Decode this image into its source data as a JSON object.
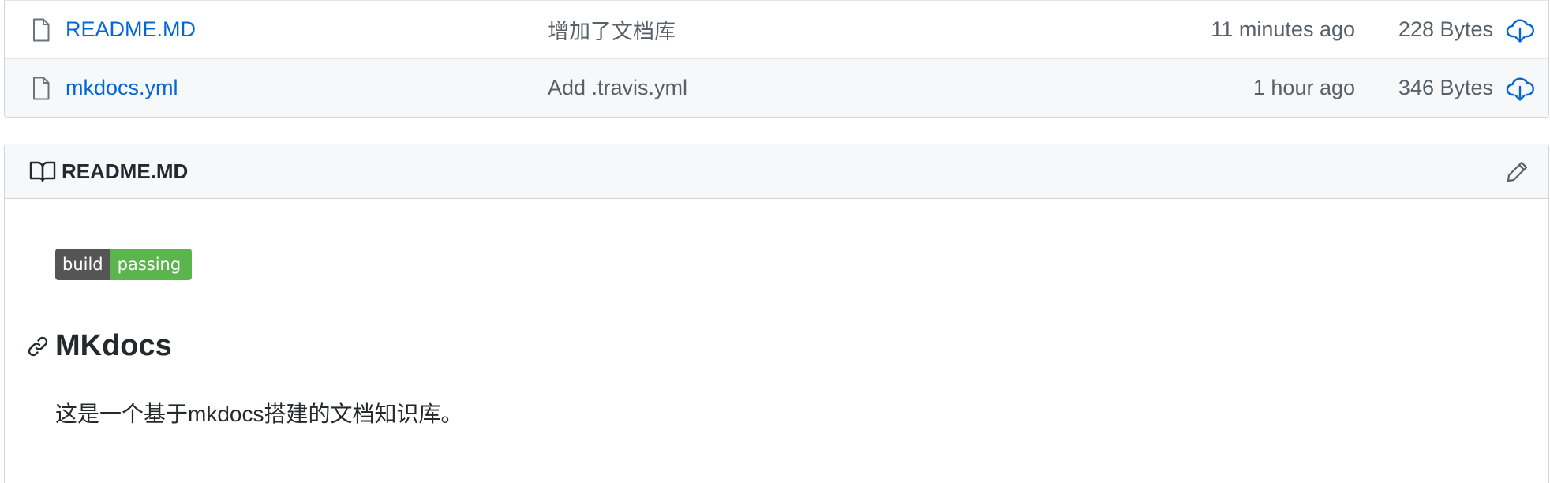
{
  "files": [
    {
      "name": "README.MD",
      "commit_message": "增加了文档库",
      "age": "11 minutes ago",
      "size": "228 Bytes",
      "icon": "file-icon"
    },
    {
      "name": "mkdocs.yml",
      "commit_message": "Add .travis.yml",
      "age": "1 hour ago",
      "size": "346 Bytes",
      "icon": "file-icon"
    }
  ],
  "readme": {
    "header_title": "README.MD",
    "header_icon": "book-icon",
    "edit_icon": "pencil-icon",
    "badge": {
      "label": "build",
      "status": "passing",
      "label_color": "#555555",
      "status_color": "#59b54c"
    },
    "heading": "MKdocs",
    "anchor_icon": "link-icon",
    "paragraph": "这是一个基于mkdocs搭建的文档知识库。"
  },
  "colors": {
    "link": "#0366d6",
    "muted": "#586069",
    "text": "#24292e",
    "border": "#d1d5da",
    "header_bg": "#f6f8fa"
  }
}
